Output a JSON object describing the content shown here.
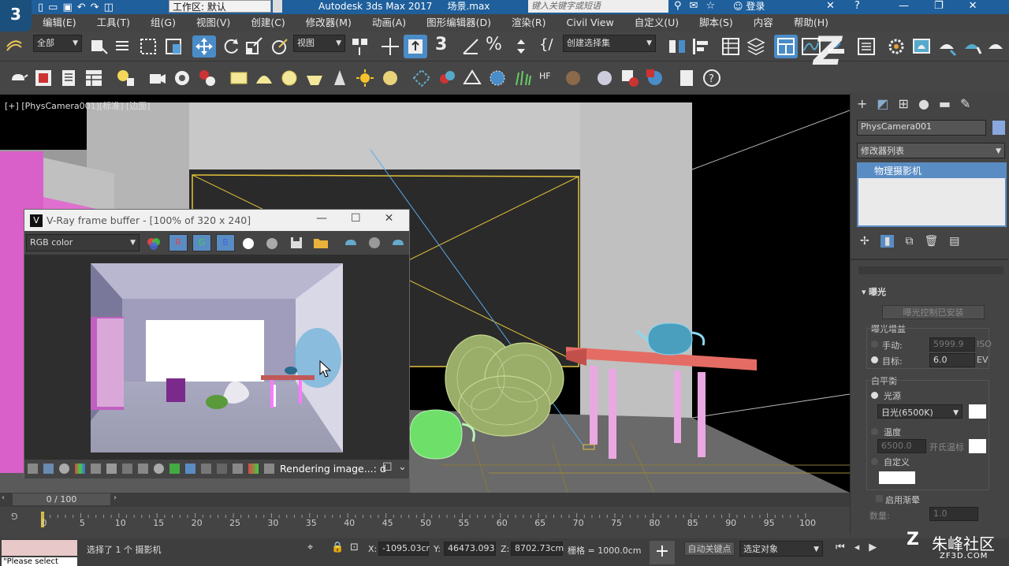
{
  "app": {
    "logo_text": "3",
    "workspace_label": "工作区: 默认",
    "title": "Autodesk 3ds Max 2017",
    "file_name": "场景.max",
    "search_placeholder": "键入关键字或短语",
    "login_label": "登录"
  },
  "menu": [
    "编辑(E)",
    "工具(T)",
    "组(G)",
    "视图(V)",
    "创建(C)",
    "修改器(M)",
    "动画(A)",
    "图形编辑器(D)",
    "渲染(R)",
    "Civil View",
    "自定义(U)",
    "脚本(S)",
    "内容",
    "帮助(H)"
  ],
  "toolbar": {
    "filter_select": "全部",
    "view_select": "视图",
    "selection_set": "创建选择集"
  },
  "viewport": {
    "label_plus": "[+]",
    "label_camera": "[PhysCamera001]",
    "label_shading": "[标准]",
    "label_edge": "[边面]"
  },
  "vfb": {
    "title": "V-Ray frame buffer - [100% of 320 x 240]",
    "channel_select": "RGB color",
    "btn_r": "R",
    "btn_g": "G",
    "btn_b": "B",
    "status_text": "Rendering image...: d"
  },
  "panel": {
    "object_name": "PhysCamera001",
    "modifier_list": "修改器列表",
    "stack_item": "物理摄影机",
    "exposure_rollout": "曝光",
    "exposure_control_btn": "曝光控制已安装",
    "exposure_gain_group": "曝光增益",
    "manual_label": "手动:",
    "manual_value": "5999.9",
    "manual_unit": "ISO",
    "target_label": "目标:",
    "target_value": "6.0",
    "target_unit": "EV",
    "white_balance_group": "白平衡",
    "illuminant_label": "光源",
    "illuminant_select": "日光(6500K)",
    "temperature_label": "温度",
    "temperature_value": "6500.0",
    "kelvin_label": "开氏温标",
    "custom_label": "自定义",
    "vignette_label": "启用渐晕",
    "amount_label": "数量:",
    "amount_value": "1.0"
  },
  "timeline": {
    "frame_counter": "0 / 100",
    "ticks": [
      "0",
      "5",
      "10",
      "15",
      "20",
      "25",
      "30",
      "35",
      "40",
      "45",
      "50",
      "55",
      "60",
      "65",
      "70",
      "75",
      "80",
      "85",
      "90",
      "95",
      "100"
    ]
  },
  "status": {
    "message": "选择了 1 个 摄影机",
    "script_text": "\"Please select",
    "x_label": "X:",
    "x_value": "-1095.03cr",
    "y_label": "Y:",
    "y_value": "46473.093",
    "z_label": "Z:",
    "z_value": "8702.73cm",
    "grid_label": "栅格 = 1000.0cm",
    "autokey_label": "自动关键点",
    "selected_label": "选定对象"
  },
  "watermark": {
    "site": "朱峰社区",
    "domain": "ZF3D.COM"
  }
}
